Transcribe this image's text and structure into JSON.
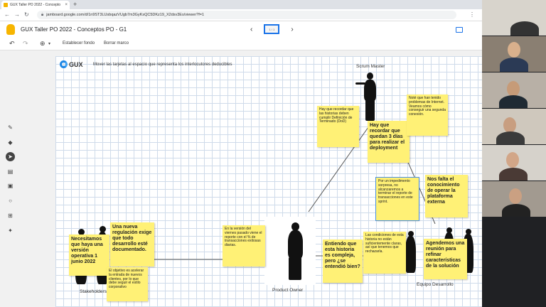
{
  "browser": {
    "tab_title": "GUX Taller PO 2022 - Concepto",
    "tab_close": "×",
    "new_tab": "+",
    "url": "jamboard.google.com/d/1n9ST3LUsbqazVUgb7m3GyKsQC5DKz19_X2dsv3Es/viewer?f=1"
  },
  "app": {
    "title": "GUX Taller PO 2022 - Conceptos PO - G1",
    "frame_prev": "‹",
    "frame_next": "›",
    "frame_thumb": "1 / 1"
  },
  "toolbar": {
    "undo": "↶",
    "redo": "↷",
    "zoom": "⊕",
    "zoom_menu": "▾",
    "set_background": "Establecer fondo",
    "clear_frame": "Borrar marco"
  },
  "sidetools": {
    "pen": "✎",
    "eraser": "◆",
    "select": "➤",
    "sticky": "▤",
    "image": "▣",
    "circle": "○",
    "textbox": "⊞",
    "laser": "✦"
  },
  "board": {
    "brand": "GUX",
    "instruction": "Mover las tarjetas al espacio que representa los interlocutores deducibles",
    "labels": {
      "scrum_master": "Scrum Master",
      "product_owner": "Product Owner",
      "stakeholders": "Stakeholders",
      "team": "Equipo Desarrollo"
    }
  },
  "notes": {
    "n1": "Hay que recordar que las historias deben cumplir Definición de Terminado (DoD)",
    "n2": "Hay que recordar que quedan 3 días para realizar el deployment",
    "n3": "Noté que han tenido problemas de Internet. Veamos cómo conseguir una segunda conexión.",
    "n4": "Por un impedimento sorpresa, no alcanzaremos a terminar el reporte de transacciones en este sprint.",
    "n5": "Nos falta el conocimiento de operar la plataforma externa",
    "n6": "En la versión del viernes pasado viene el reporte con el % de transacciones exitosas diarias.",
    "n7": "Necesitamos que haya una versión operativa 1 junio 2022",
    "n8": "Una nueva regulación exige que todo desarrollo esté documentado.",
    "n9": "El objetivo es acelerar la entrada de nuevos clientes, por lo que debe seguir el estilo corporativo",
    "n10": "Entiendo que esta historia es compleja, pero ¿se entendió bien?",
    "n11": "Las condiciones de esta historia no están suficientemente claras, así que tenemos que rechazarla.",
    "n12": "Agendemos una reunión para refinar características de la solución"
  },
  "colors": {
    "sticky": "#fff176",
    "jamboard_yellow": "#f7b500",
    "grid": "#cfdbea",
    "accent_blue": "#1a73e8"
  }
}
